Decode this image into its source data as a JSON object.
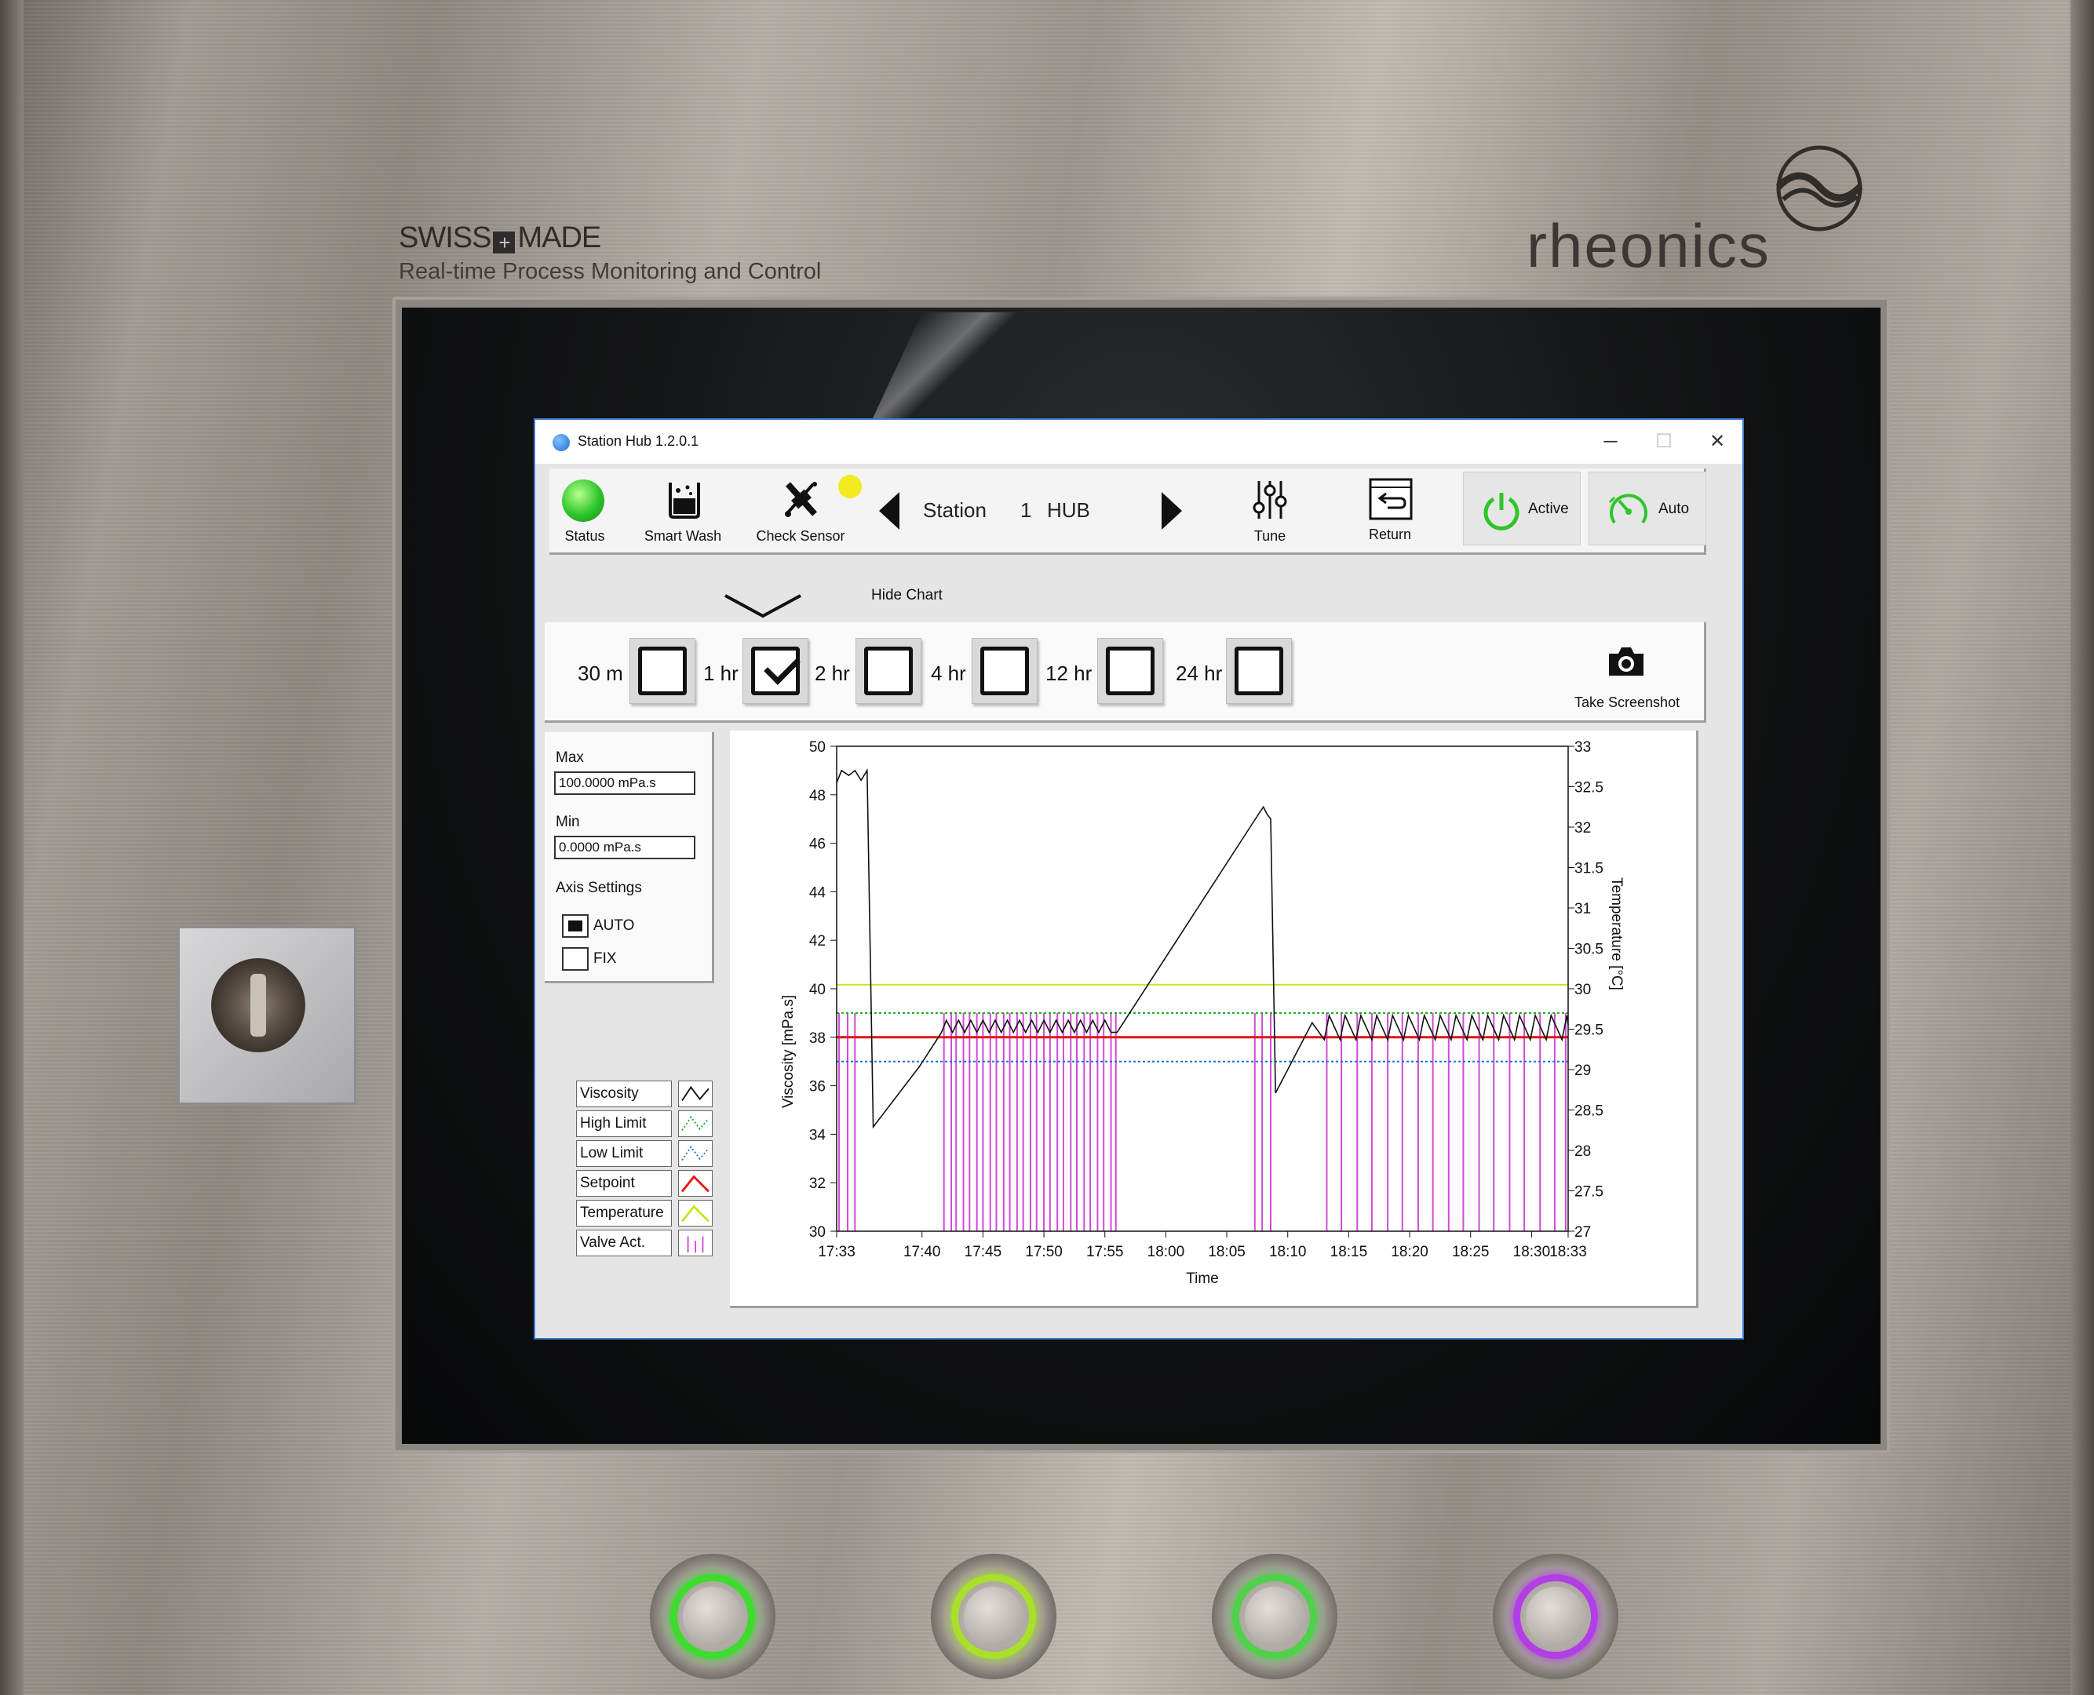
{
  "enclosure": {
    "swiss_made": [
      "SWISS",
      "MADE"
    ],
    "tagline": "Real-time Process Monitoring and Control",
    "brand": "rheonics",
    "button_ring_colors": [
      "#3ddc2e",
      "#a8e02a",
      "#4fd14a",
      "#b23ee6"
    ]
  },
  "window": {
    "title": "Station Hub 1.2.0.1",
    "minimize": "─",
    "maximize": "☐",
    "close": "✕"
  },
  "toolbar": {
    "status_label": "Status",
    "status_color": "#2ec52b",
    "smart_wash_label": "Smart Wash",
    "check_sensor_label": "Check Sensor",
    "check_sensor_indicator": "#f3ea1f",
    "station_label": "Station",
    "station_number": "1",
    "station_name": "HUB",
    "tune_label": "Tune",
    "return_label": "Return",
    "active_label": "Active",
    "auto_label": "Auto",
    "icons": {
      "smart_wash": "beaker-icon",
      "check_sensor": "sensor-icon",
      "tune": "sliders-icon",
      "return": "return-icon",
      "active": "power-icon",
      "auto": "gauge-icon",
      "prev": "triangle-left-icon",
      "next": "triangle-right-icon"
    }
  },
  "chart_toggle": {
    "label": "Hide Chart"
  },
  "time_ranges": [
    {
      "label": "30 m",
      "checked": false
    },
    {
      "label": "1 hr",
      "checked": true
    },
    {
      "label": "2 hr",
      "checked": false
    },
    {
      "label": "4 hr",
      "checked": false
    },
    {
      "label": "12 hr",
      "checked": false
    },
    {
      "label": "24 hr",
      "checked": false
    }
  ],
  "screenshot": {
    "label": "Take Screenshot",
    "icon": "camera-icon"
  },
  "axis": {
    "max_label": "Max",
    "max_value": "100.0000 mPa.s",
    "min_label": "Min",
    "min_value": "0.0000 mPa.s",
    "settings_label": "Axis Settings",
    "auto_label": "AUTO",
    "auto_checked": true,
    "fix_label": "FIX",
    "fix_checked": false
  },
  "legend": [
    {
      "name": "Viscosity",
      "color": "#111111"
    },
    {
      "name": "High Limit",
      "color": "#1aa51a"
    },
    {
      "name": "Low Limit",
      "color": "#1f6fd0"
    },
    {
      "name": "Setpoint",
      "color": "#e01414"
    },
    {
      "name": "Temperature",
      "color": "#c8e61e"
    },
    {
      "name": "Valve Act.",
      "color": "#d04bd8"
    }
  ],
  "chart_data": {
    "type": "line",
    "xlabel": "Time",
    "ylabel": "Viscosity [mPa.s]",
    "y2label": "Temperature [°C]",
    "x_ticks": [
      "17:33",
      "17:40",
      "17:45",
      "17:50",
      "17:55",
      "18:00",
      "18:05",
      "18:10",
      "18:15",
      "18:20",
      "18:25",
      "18:30",
      "18:33"
    ],
    "x_range": [
      "17:33",
      "18:33"
    ],
    "y_ticks": [
      "30",
      "32",
      "34",
      "36",
      "38",
      "40",
      "42",
      "44",
      "46",
      "48",
      "50"
    ],
    "ylim": [
      30,
      50
    ],
    "y2_ticks": [
      "27",
      "27.5",
      "28",
      "28.5",
      "29",
      "29.5",
      "30",
      "30.5",
      "31",
      "31.5",
      "32",
      "32.5",
      "33"
    ],
    "y2lim": [
      27,
      33
    ],
    "series": [
      {
        "name": "Viscosity",
        "x_minutes_from_1733": [
          0,
          0.4,
          1,
          1.5,
          2,
          2.5,
          3,
          6.8,
          8.6,
          9,
          9.5,
          10,
          10.5,
          11,
          11.5,
          12,
          12.5,
          13,
          13.5,
          14,
          14.5,
          15,
          15.5,
          16,
          16.5,
          17,
          17.5,
          18,
          18.5,
          19,
          19.5,
          20,
          20.5,
          21,
          21.5,
          22,
          22.5,
          23,
          34.6,
          35,
          35.3,
          35.6,
          36,
          39,
          40,
          40.4,
          41.3,
          41.7,
          42.6,
          43,
          43.9,
          44.3,
          45.2,
          45.6,
          46.5,
          46.9,
          47.8,
          48.2,
          49.1,
          49.5,
          50.4,
          50.8,
          51.7,
          52.1,
          53,
          53.4,
          54.3,
          54.7,
          55.6,
          56,
          56.9,
          57.3,
          58.2,
          58.6,
          59.5,
          59.9,
          60
        ],
        "values": [
          48.5,
          49.0,
          48.8,
          49.0,
          48.6,
          49.0,
          34.3,
          36.8,
          38.2,
          38.7,
          38.2,
          38.7,
          38.2,
          38.7,
          38.2,
          38.7,
          38.2,
          38.7,
          38.2,
          38.7,
          38.2,
          38.7,
          38.2,
          38.7,
          38.2,
          38.7,
          38.2,
          38.7,
          38.2,
          38.7,
          38.2,
          38.7,
          38.2,
          38.7,
          38.2,
          38.7,
          38.2,
          38.2,
          47.2,
          47.5,
          47.2,
          47.0,
          35.7,
          38.6,
          37.9,
          38.9,
          37.9,
          38.9,
          37.9,
          38.9,
          37.9,
          38.9,
          37.9,
          38.9,
          37.9,
          38.9,
          37.9,
          38.9,
          37.9,
          38.9,
          37.9,
          38.9,
          37.9,
          38.9,
          37.9,
          38.9,
          37.9,
          38.9,
          37.9,
          38.9,
          37.9,
          38.9,
          37.9,
          38.9,
          37.9,
          38.9,
          38.5
        ]
      },
      {
        "name": "High Limit",
        "values": [
          39.0,
          39.0
        ]
      },
      {
        "name": "Low Limit",
        "values": [
          37.0,
          37.0
        ]
      },
      {
        "name": "Setpoint",
        "values": [
          38.0,
          38.0
        ]
      },
      {
        "name": "Temperature",
        "values": [
          30.05,
          30.05
        ],
        "axis": "y2"
      },
      {
        "name": "Valve Act.",
        "x_minutes_from_1733": [
          0.2,
          0.9,
          1.5,
          8.8,
          9.4,
          9.8,
          10.4,
          10.9,
          11.5,
          12.0,
          12.6,
          13.1,
          13.7,
          14.2,
          14.8,
          15.3,
          15.9,
          16.4,
          17.0,
          17.5,
          18.1,
          18.6,
          19.2,
          19.7,
          20.3,
          20.8,
          21.4,
          21.9,
          22.5,
          22.9,
          34.3,
          34.9,
          35.6,
          40.2,
          41.4,
          42.7,
          43.9,
          45.2,
          46.4,
          47.7,
          48.9,
          50.2,
          51.4,
          52.7,
          53.9,
          55.2,
          56.4,
          57.7,
          58.9,
          59.8
        ],
        "pulse_top": 39.0,
        "pulse_bottom": 30.0
      }
    ]
  }
}
